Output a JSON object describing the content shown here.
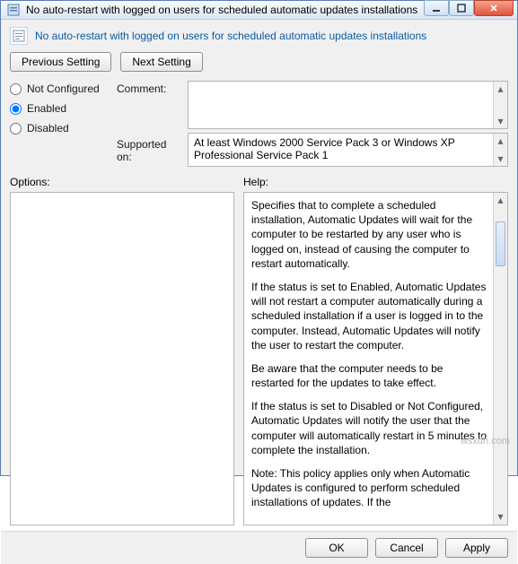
{
  "window": {
    "title": "No auto-restart with logged on users for scheduled automatic updates installations"
  },
  "header": {
    "policy_title": "No auto-restart with logged on users for scheduled automatic updates installations"
  },
  "nav": {
    "previous": "Previous Setting",
    "next": "Next Setting"
  },
  "state": {
    "not_configured": "Not Configured",
    "enabled": "Enabled",
    "disabled": "Disabled",
    "selected": "enabled"
  },
  "comment": {
    "label": "Comment:",
    "value": ""
  },
  "supported": {
    "label": "Supported on:",
    "value": "At least Windows 2000 Service Pack 3 or Windows XP Professional Service Pack 1"
  },
  "options": {
    "label": "Options:"
  },
  "help": {
    "label": "Help:",
    "p1": "Specifies that to complete a scheduled installation, Automatic Updates will wait for the computer to be restarted by any user who is logged on, instead of causing the computer to restart automatically.",
    "p2": "If the status is set to Enabled, Automatic Updates will not restart a computer automatically during a scheduled installation if a user is logged in to the computer. Instead, Automatic Updates will notify the user to restart the computer.",
    "p3": "Be aware that the computer needs to be restarted for the updates to take effect.",
    "p4": "If the status is set to Disabled or Not Configured, Automatic Updates will notify the user that the computer will automatically restart in 5 minutes to complete the installation.",
    "p5": "Note: This policy applies only when Automatic Updates is configured to perform scheduled installations of updates. If the"
  },
  "buttons": {
    "ok": "OK",
    "cancel": "Cancel",
    "apply": "Apply"
  },
  "watermark": "wsxdn.com"
}
